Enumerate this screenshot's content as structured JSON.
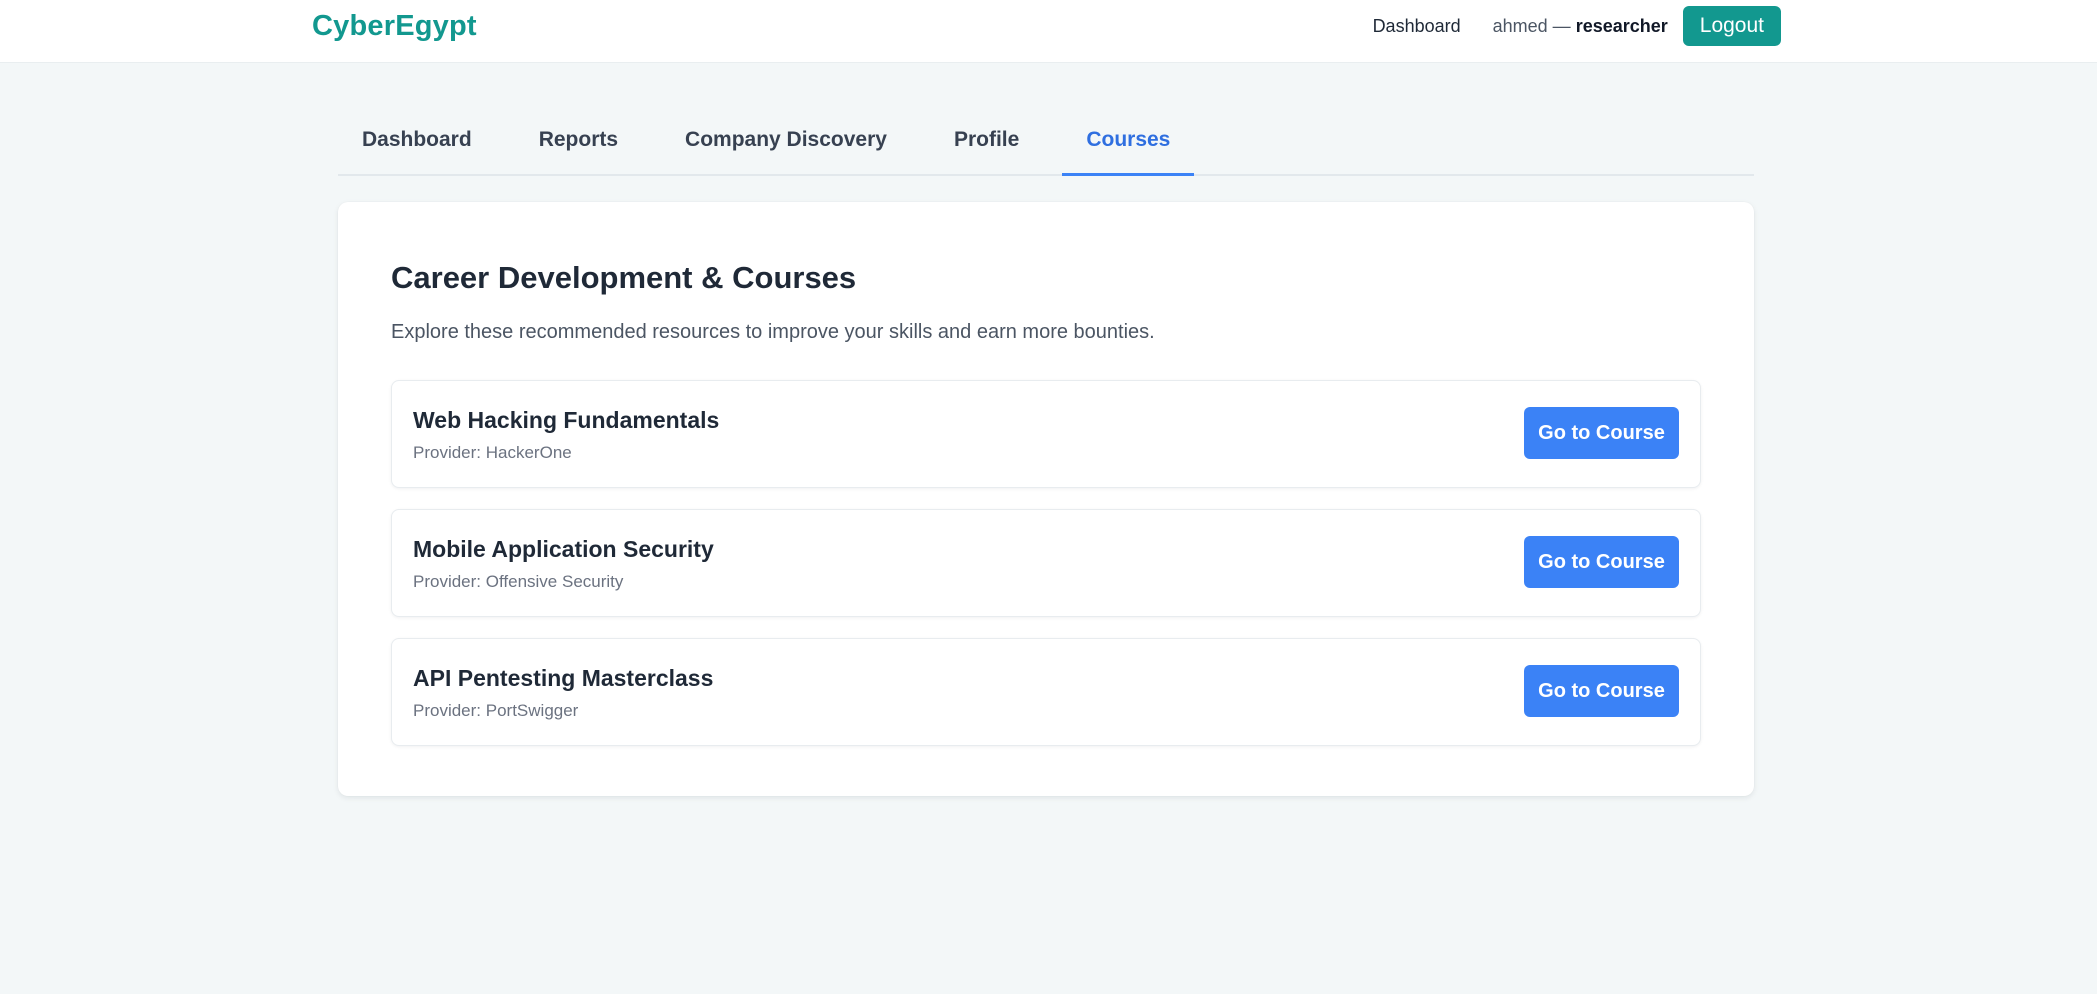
{
  "header": {
    "brand": "CyberEgypt",
    "nav_dashboard": "Dashboard",
    "username": "ahmed",
    "separator": " — ",
    "role": "researcher",
    "logout_label": "Logout"
  },
  "tabs": [
    {
      "label": "Dashboard",
      "active": false
    },
    {
      "label": "Reports",
      "active": false
    },
    {
      "label": "Company Discovery",
      "active": false
    },
    {
      "label": "Profile",
      "active": false
    },
    {
      "label": "Courses",
      "active": true
    }
  ],
  "main": {
    "title": "Career Development & Courses",
    "subtitle": "Explore these recommended resources to improve your skills and earn more bounties.",
    "courses": [
      {
        "name": "Web Hacking Fundamentals",
        "provider": "Provider: HackerOne",
        "button_label": "Go to Course"
      },
      {
        "name": "Mobile Application Security",
        "provider": "Provider: Offensive Security",
        "button_label": "Go to Course"
      },
      {
        "name": "API Pentesting Masterclass",
        "provider": "Provider: PortSwigger",
        "button_label": "Go to Course"
      }
    ]
  },
  "colors": {
    "brand": "#12988f",
    "accent": "#3b82f6",
    "active_tab": "#2f6fe0",
    "background": "#f3f7f8"
  }
}
